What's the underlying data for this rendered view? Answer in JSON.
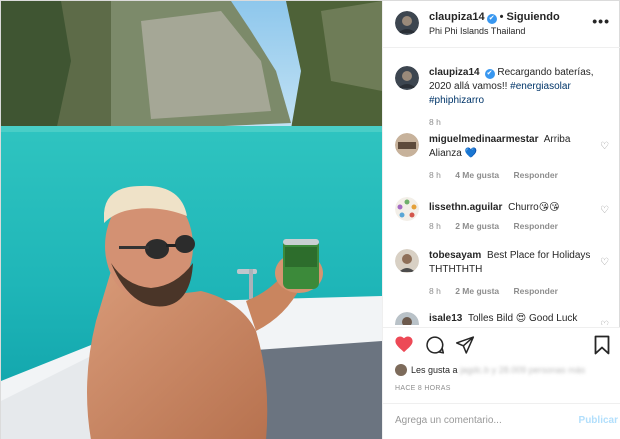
{
  "post": {
    "username": "claupiza14",
    "verified_mark": "✔",
    "separator": "•",
    "follow_status": "Siguiendo",
    "location": "Phi Phi Islands Thailand",
    "more_icon": "more-options-icon"
  },
  "caption": {
    "username": "claupiza14",
    "text": "Recargando baterías, 2020 allá vamos!!",
    "hashtags": [
      "#energiasolar",
      "#phiphizarro"
    ],
    "time": "8 h"
  },
  "comments": [
    {
      "username": "miguelmedinaarmestar",
      "text": "Arriba Alianza",
      "emoji": "💙",
      "time": "8 h",
      "likes": "4 Me gusta",
      "reply": "Responder"
    },
    {
      "username": "lissethn.aguilar",
      "text": "Churro",
      "emoji": "😘😘",
      "time": "8 h",
      "likes": "2 Me gusta",
      "reply": "Responder"
    },
    {
      "username": "tobesayam",
      "text": "Best Place for Holidays THTHTHTH",
      "emoji": "",
      "time": "8 h",
      "likes": "2 Me gusta",
      "reply": "Responder"
    },
    {
      "username": "isale13",
      "text": "Tolles Bild",
      "emoji": "😍",
      "extra": "Good Luck",
      "time": "",
      "likes": "",
      "reply": ""
    }
  ],
  "actions": {
    "likes_prefix": "Les gusta a",
    "likes_blurred": "jagdc.b y 28.009 personas más",
    "timestamp": "HACE 8 HORAS",
    "comment_placeholder": "Agrega un comentario...",
    "publish_label": "Publicar"
  },
  "colors": {
    "like_red": "#ed4956",
    "link_blue": "#003569",
    "verified_blue": "#3897f0",
    "publish_disabled": "#b2dffc"
  }
}
